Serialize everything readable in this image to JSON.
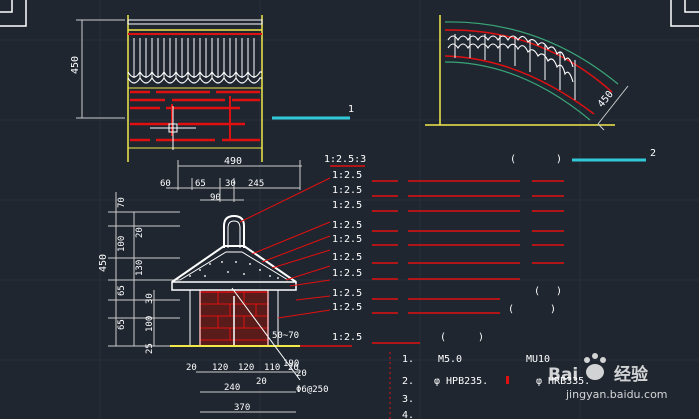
{
  "drawing": {
    "top_elevation": {
      "height_dim": "450",
      "tag": "1"
    },
    "curved_elevation": {
      "dim": "450",
      "tag": "2"
    },
    "section": {
      "width_total": "490",
      "top_dims": [
        "60",
        "65",
        "30",
        "245"
      ],
      "sub_dim": "90",
      "left_dims": [
        "70",
        "20",
        "100",
        "450",
        "130",
        "65",
        "30",
        "65",
        "100",
        "25"
      ],
      "right_dim": "50~70",
      "bottom_dims_row1": [
        "20",
        "120",
        "120",
        "110",
        "20"
      ],
      "bottom_dims_row2": [
        "240",
        "20"
      ],
      "bottom_dims_row3": [
        "370"
      ],
      "extra_dims": [
        "190",
        "20"
      ],
      "rebar_callout": "Φ6@250"
    },
    "mix_labels": [
      "1:2.5:3",
      "1:2.5",
      "1:2.5",
      "1:2.5",
      "1:2.5",
      "1:2.5",
      "1:2.5",
      "1:2.5",
      "1:2.5",
      "1:2.5",
      "1:2.5"
    ],
    "paren_marks": [
      "(",
      ")",
      "(",
      ")",
      "(",
      ")",
      "(",
      ")",
      "(",
      ")."
    ],
    "notes": {
      "n1": "1.",
      "n1_a": "M5.0",
      "n1_b": "MU10",
      "n2": "2.",
      "n2_a": "φ  HPB235.",
      "n2_b": "φ  HRB335.",
      "n3": "3.",
      "n4": "4."
    }
  },
  "watermark": {
    "brand": "Bai",
    "brand_cn": "经验",
    "url": "jingyan.baidu.com"
  },
  "colors": {
    "background": "#1f2630",
    "red": "#e01010",
    "yellow": "#f2e84c",
    "cyan": "#32c8d8",
    "white": "#ffffff"
  }
}
